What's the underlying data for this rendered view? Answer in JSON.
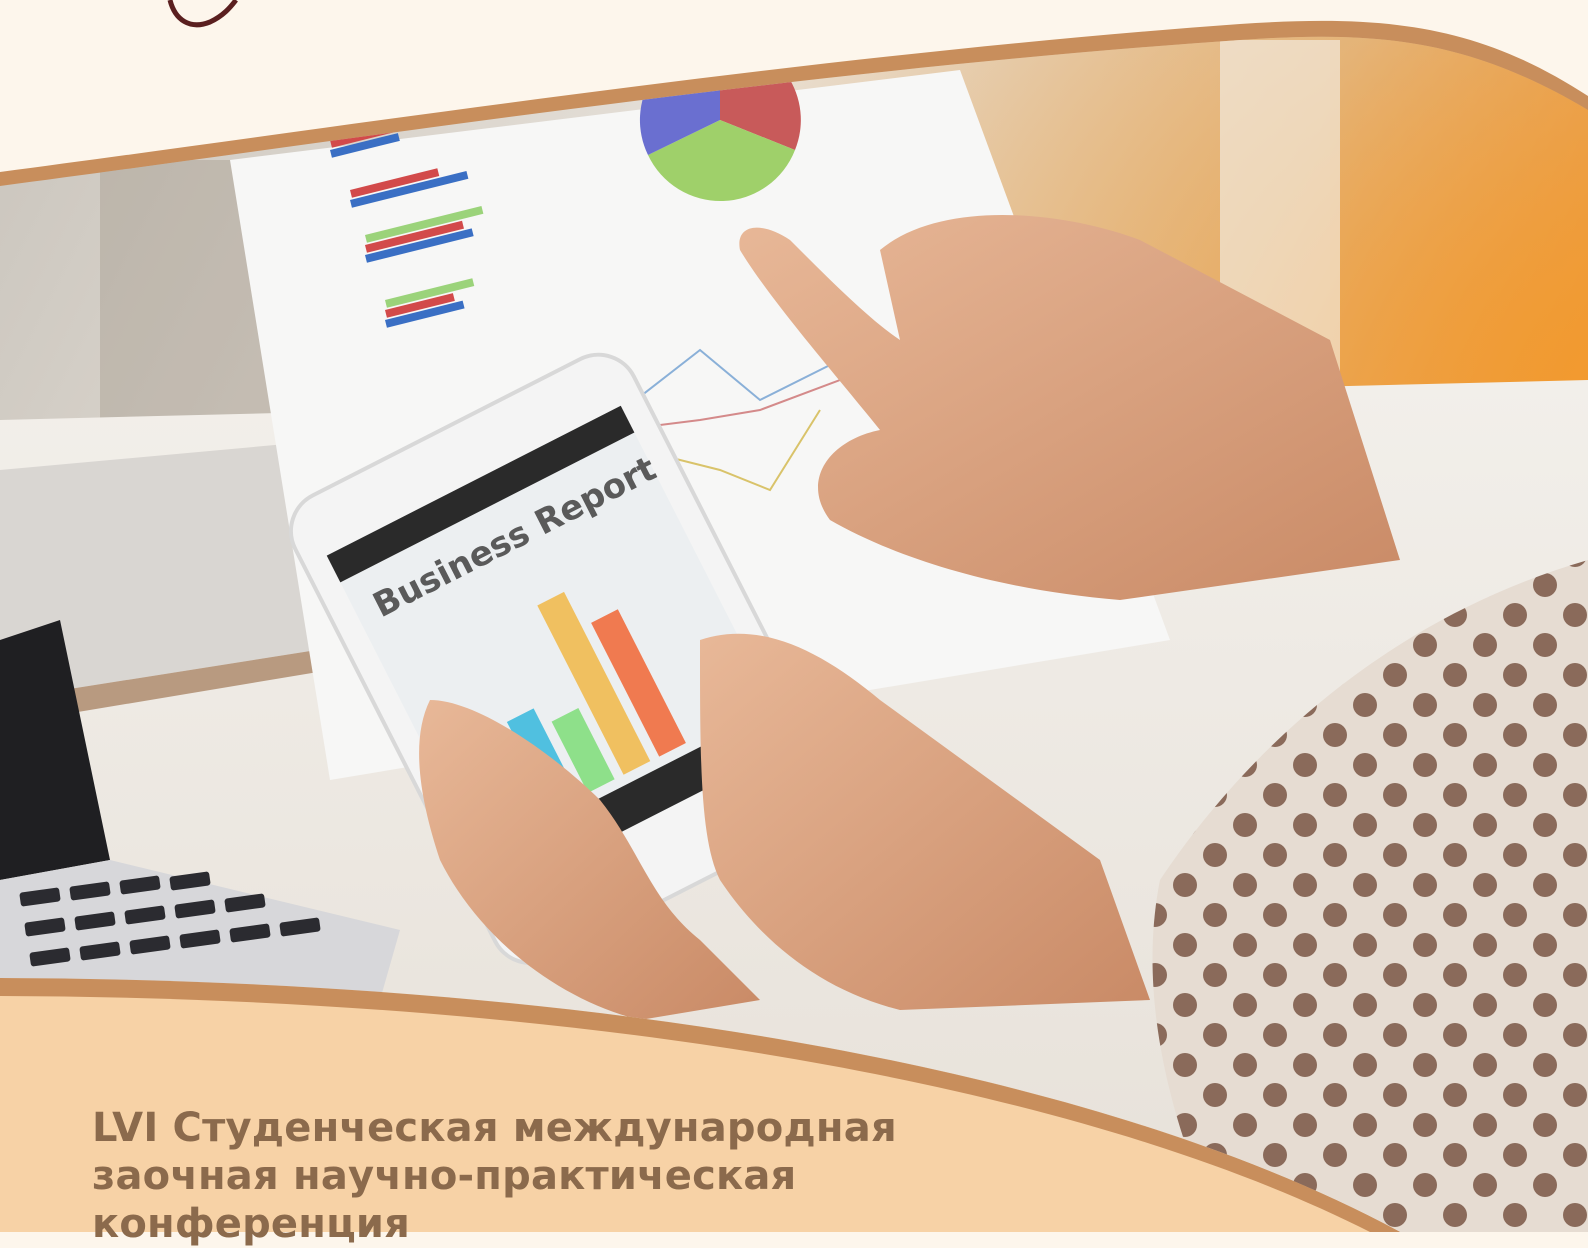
{
  "cover": {
    "photo_subject": "business-report-photo",
    "screen_title": "Business Report",
    "conference_lines": [
      "LVI Студенческая международная",
      "заочная научно-практическая",
      "конференция"
    ]
  },
  "colors": {
    "cream": "#fdf6ec",
    "peach_band": "#f7d2a6",
    "copper_border": "#c88e5c",
    "caption_text": "#8b6a4c",
    "logo_stroke": "#5a1f1f"
  }
}
